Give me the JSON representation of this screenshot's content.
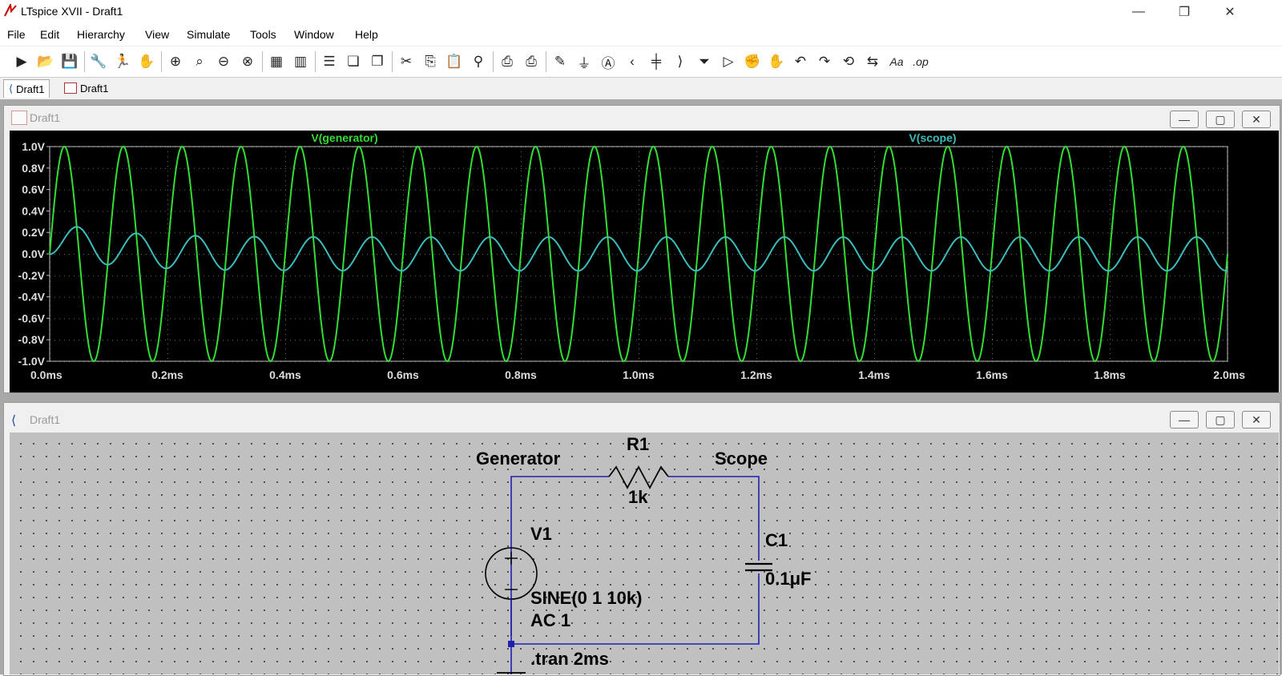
{
  "app": {
    "title": "LTspice XVII - Draft1",
    "controls": {
      "minimize": "—",
      "restore": "❐",
      "close": "✕"
    }
  },
  "menu": [
    {
      "label": "File"
    },
    {
      "label": "Edit"
    },
    {
      "label": "Hierarchy"
    },
    {
      "label": "View"
    },
    {
      "label": "Simulate"
    },
    {
      "label": "Tools"
    },
    {
      "label": "Window"
    },
    {
      "label": "Help"
    }
  ],
  "toolbar": {
    "icons": [
      "new-schematic-icon",
      "open-icon",
      "save-icon",
      "control-panel-icon",
      "run-icon",
      "halt-icon",
      "zoom-in-icon",
      "zoom-area-icon",
      "zoom-out-icon",
      "zoom-cancel-icon",
      "autorange-icon",
      "mark-icon",
      "tile-horizontal-icon",
      "cascade-icon",
      "tile-vertical-icon",
      "cut-icon",
      "copy-icon",
      "paste-icon",
      "find-icon",
      "print-icon",
      "print-setup-icon",
      "wire-icon",
      "ground-icon",
      "label-net-icon",
      "resistor-icon",
      "capacitor-icon",
      "inductor-icon",
      "diode-icon",
      "component-icon",
      "move-icon",
      "drag-icon",
      "undo-icon",
      "redo-icon",
      "rotate-icon",
      "mirror-icon",
      "text-icon",
      "spice-directive-icon"
    ],
    "text_icon": "Aa",
    "directive_icon": ".op"
  },
  "tabs": [
    {
      "label": "Draft1",
      "icon": "schematic-icon"
    },
    {
      "label": "Draft1",
      "icon": "waveform-icon"
    }
  ],
  "waveform_window": {
    "title": "Draft1",
    "buttons": {
      "minimize": "—",
      "maximize": "▢",
      "close": "✕"
    }
  },
  "schematic_window": {
    "title": "Draft1",
    "buttons": {
      "minimize": "—",
      "maximize": "▢",
      "close": "✕"
    }
  },
  "chart_data": {
    "type": "line",
    "title": "",
    "xlabel": "",
    "ylabel": "",
    "xlim": [
      0,
      2.0
    ],
    "ylim": [
      -1.0,
      1.0
    ],
    "x_ticks": [
      "0.0ms",
      "0.2ms",
      "0.4ms",
      "0.6ms",
      "0.8ms",
      "1.0ms",
      "1.2ms",
      "1.4ms",
      "1.6ms",
      "1.8ms",
      "2.0ms"
    ],
    "y_ticks": [
      "1.0V",
      "0.8V",
      "0.6V",
      "0.4V",
      "0.2V",
      "0.0V",
      "-0.2V",
      "-0.4V",
      "-0.6V",
      "-0.8V",
      "-1.0V"
    ],
    "background": "#000000",
    "series": [
      {
        "name": "V(generator)",
        "color": "#33dd33",
        "amplitude": 1.0,
        "frequency_khz": 10,
        "offset": 0
      },
      {
        "name": "V(scope)",
        "color": "#3cbcbc",
        "amplitude": 0.157,
        "frequency_khz": 10,
        "phase_lag_deg": 81,
        "first_peak": 0.25
      }
    ]
  },
  "schematic": {
    "net_generator": "Generator",
    "net_scope": "Scope",
    "r_name": "R1",
    "r_value": "1k",
    "v_name": "V1",
    "v_value": "SINE(0 1 10k)",
    "v_ac": "AC 1",
    "c_name": "C1",
    "c_value": "0.1μF",
    "directive": ".tran 2ms",
    "wire_color": "#2020b0"
  }
}
